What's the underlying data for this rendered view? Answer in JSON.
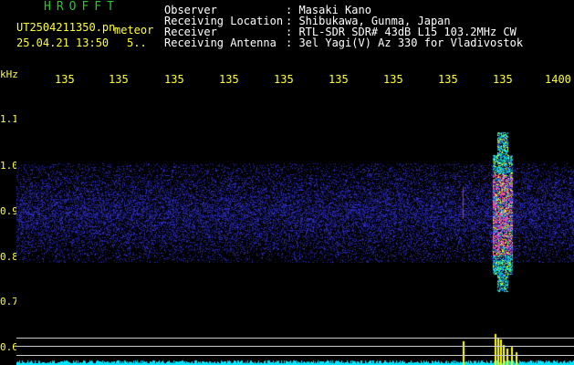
{
  "header": {
    "app_name": "HROFFT",
    "file_name": "UT2504211350.pn",
    "mode": "meteor",
    "date_time": "25.04.21 13:50",
    "small_value": "5.."
  },
  "station": {
    "rows": [
      {
        "label": "Observer",
        "value": ": Masaki Kano"
      },
      {
        "label": "Receiving Location",
        "value": ": Shibukawa, Gunma, Japan"
      },
      {
        "label": "Receiver",
        "value": ": RTL-SDR SDR# 43dB L15 103.2MHz CW"
      },
      {
        "label": "Receiving Antenna",
        "value": ": 3el Yagi(V) Az 330 for Vladivostok"
      }
    ]
  },
  "x_axis": {
    "ticks": [
      "135",
      "135",
      "135",
      "135",
      "135",
      "135",
      "135",
      "135",
      "135",
      "1400"
    ]
  },
  "y_axis": {
    "unit": "kHz",
    "ticks": [
      "1.1",
      "1.0",
      "0.9",
      "0.8",
      "0.7",
      "0.6"
    ]
  },
  "colors": {
    "header_text": "#ffffff",
    "app_name": "#2cc52c",
    "axis_labels": "#ffff33",
    "noise": "#2a2aa8",
    "spectrum": "#00e5ff",
    "signal_peak": "#ffff00",
    "background": "#000000"
  }
}
